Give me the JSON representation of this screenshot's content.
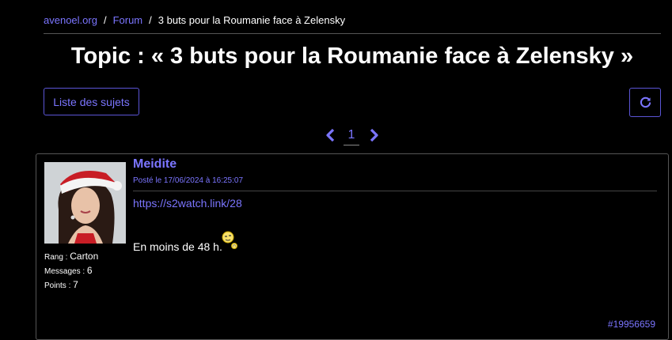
{
  "breadcrumb": {
    "home": "avenoel.org",
    "forum": "Forum",
    "current": "3 buts pour la Roumanie face à Zelensky"
  },
  "page_title": "Topic : « 3 buts pour la Roumanie face à Zelensky »",
  "toolbar": {
    "list_label": "Liste des sujets",
    "refresh_icon": "refresh-icon"
  },
  "pagination": {
    "current_page": "1",
    "prev_icon": "chevron-left-icon",
    "next_icon": "chevron-right-icon"
  },
  "post": {
    "author": "Meidite",
    "date": "Posté le 17/06/2024 à 16:25:07",
    "link": "https://s2watch.link/28",
    "text": "En moins de 48 h.",
    "emoji_icon": "clock-face-icon",
    "id": "#19956659",
    "meta": [
      {
        "label": "Rang",
        "value": "Carton"
      },
      {
        "label": "Messages",
        "value": "6"
      },
      {
        "label": "Points",
        "value": "7"
      }
    ]
  },
  "colors": {
    "accent": "#7b75ff",
    "background": "#000000",
    "border": "#555555"
  }
}
